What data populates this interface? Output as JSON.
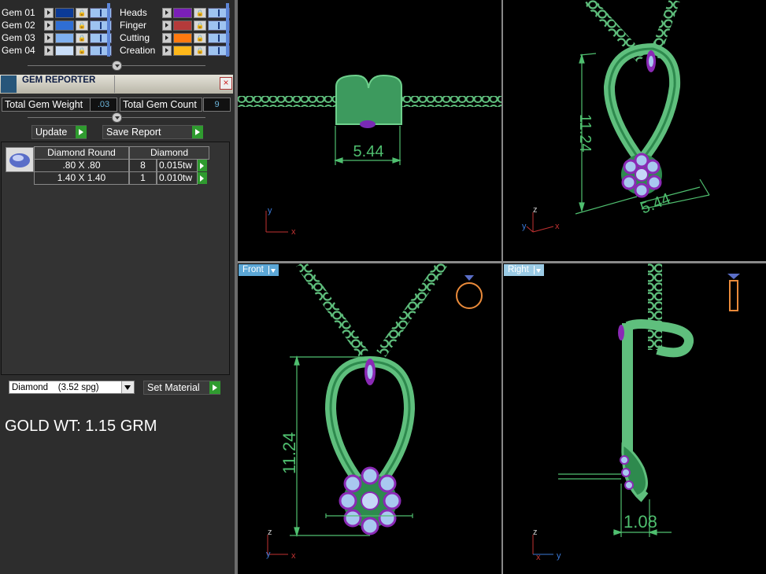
{
  "layers": {
    "left": [
      {
        "name": "Gem 01",
        "color": "#0b3a96"
      },
      {
        "name": "Gem 02",
        "color": "#2f6ed4"
      },
      {
        "name": "Gem 03",
        "color": "#7fb0ef"
      },
      {
        "name": "Gem 04",
        "color": "#c9def8"
      }
    ],
    "right": [
      {
        "name": "Heads",
        "color": "#7a1fb8"
      },
      {
        "name": "Finger",
        "color": "#b43a3a"
      },
      {
        "name": "Cutting",
        "color": "#ff7a10"
      },
      {
        "name": "Creation",
        "color": "#ffb81a"
      }
    ]
  },
  "gem_reporter": {
    "title": "GEM REPORTER",
    "total_weight_label": "Total Gem Weight",
    "total_weight_value": ".03",
    "total_count_label": "Total Gem Count",
    "total_count_value": "9",
    "update_label": "Update",
    "save_report_label": "Save Report",
    "table": {
      "header_shape": "Diamond Round",
      "header_material": "Diamond",
      "rows": [
        {
          "size": ".80 X .80",
          "count": "8",
          "weight": "0.015tw"
        },
        {
          "size": "1.40 X 1.40",
          "count": "1",
          "weight": "0.010tw"
        }
      ]
    },
    "material_value": "Diamond    (3.52 spg)",
    "set_material_label": "Set Material"
  },
  "gold_weight": "GOLD WT: 1.15 GRM",
  "viewports": {
    "top": {
      "dimension": "5.44",
      "axis_v": "y",
      "axis_h": "x"
    },
    "perspective": {
      "dim_height": "11.24",
      "dim_width": "5.44",
      "axis_z": "z",
      "axis_y": "y",
      "axis_x": "x"
    },
    "front": {
      "label": "Front",
      "dim_height": "11.24",
      "axis_z": "z",
      "axis_y": "y",
      "axis_x": "x"
    },
    "right": {
      "label": "Right",
      "dim_depth": "1.08",
      "axis_z": "z",
      "axis_x": "x",
      "axis_y": "y"
    }
  },
  "colors": {
    "metal": "#5fbf7d",
    "metal_dark": "#2e8a4e",
    "gem_purple": "#8a2ab5",
    "gem_light": "#a9c8f0",
    "dim_line": "#4fbf6f",
    "accent": "#5ca7d6"
  }
}
